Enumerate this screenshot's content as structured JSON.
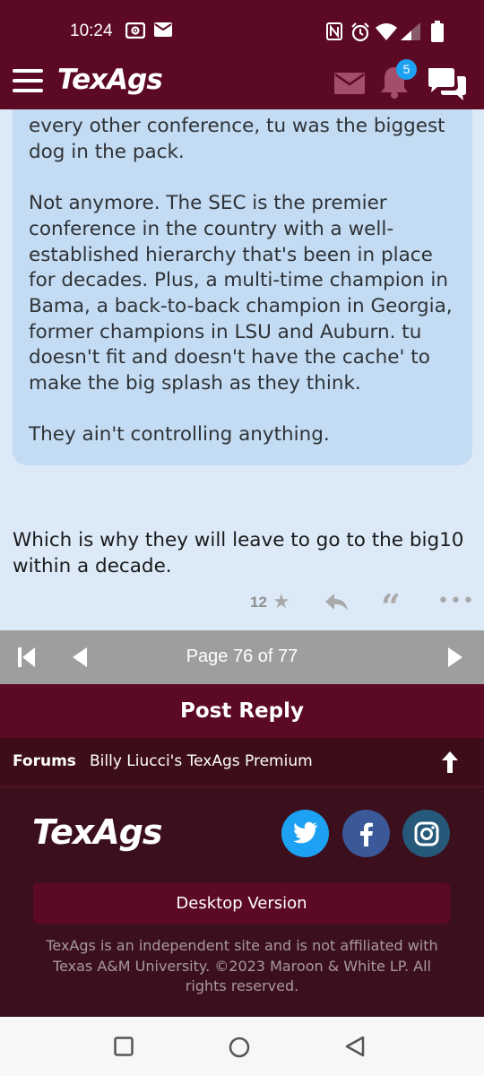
{
  "status_bar": {
    "time": "10:24"
  },
  "app_bar": {
    "logo": "TexAgs",
    "notification_count": "5"
  },
  "quote": {
    "paragraphs": [
      "every other conference, tu was the biggest dog in the pack.",
      "Not anymore. The SEC is the premier conference in the country with a well-established hierarchy that's been in place for decades. Plus, a multi-time champion in Bama, a back-to-back champion in Georgia, former champions in LSU and Auburn. tu doesn't fit and doesn't have the cache' to make the big splash as they think.",
      "They ain't controlling anything."
    ]
  },
  "reply": {
    "text": "Which is why they will leave to go to the big10 within a decade."
  },
  "actions": {
    "like_count": "12"
  },
  "pager": {
    "label": "Page 76 of 77"
  },
  "post_reply": {
    "label": "Post Reply"
  },
  "breadcrumb": {
    "forums": "Forums",
    "current": "Billy Liucci's TexAgs Premium"
  },
  "footer": {
    "logo": "TexAgs",
    "desktop_version": "Desktop Version",
    "legal": "TexAgs is an independent site and is not affiliated with Texas A&M University. ©2023 Maroon & White LP. All rights reserved."
  },
  "colors": {
    "maroon": "#5c0a24",
    "footer": "#3b0f1b",
    "page": "#dceaf8",
    "quote": "#c3dbf3"
  }
}
